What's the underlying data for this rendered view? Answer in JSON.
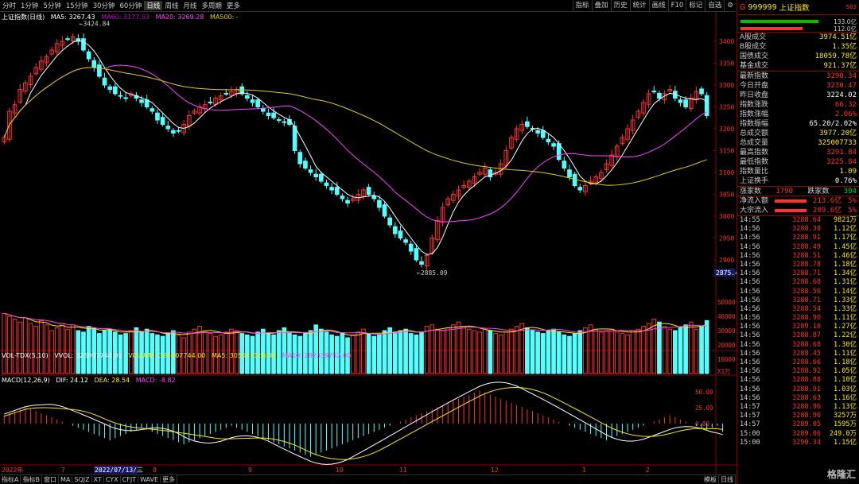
{
  "colors": {
    "up": "#ff3030",
    "down": "#54ffff",
    "ma5": "#ffffff",
    "ma60": "#c000c0",
    "ma20": "#ff40ff",
    "ma500": "#e0d000",
    "macd_dif": "#ffffff",
    "macd_dea": "#ffea00"
  },
  "periods": [
    "分时",
    "1分钟",
    "5分钟",
    "15分钟",
    "30分钟",
    "60分钟",
    "日线",
    "周线",
    "月线",
    "多周期",
    "更多"
  ],
  "active_period": "日线",
  "tools": [
    "指标",
    "叠加",
    "历史",
    "统计",
    "画线",
    "F10",
    "标记",
    "自选",
    "⚙"
  ],
  "price_legend": {
    "name": "上证指数(日线)",
    "ma5": "MA5: 3267.43",
    "ma60": "MA60: 3177.53",
    "ma20": "MA20: 3269.28",
    "ma500": "MA500: -"
  },
  "vol_legend": {
    "name": "VOL-TDX(5,10)",
    "vvol": "VVOL: 325007744.00",
    "volume": "VOLUME: 325007744.00",
    "ma5": "MA5: 305047168.00",
    "ma10": "MA10: 282339752.00"
  },
  "macd_legend": {
    "name": "MACD(12,26,9)",
    "dif": "DIF: 24.12",
    "dea": "DEA: 28.54",
    "macd": "MACD: -8.82"
  },
  "price_axis": [
    "3400",
    "3350",
    "3300",
    "3250",
    "3200",
    "3150",
    "3100",
    "3050",
    "3000",
    "2950",
    "2900"
  ],
  "vol_axis": [
    "50000",
    "40000",
    "30000",
    "20000",
    "10000"
  ],
  "vol_unit": "X1万",
  "macd_axis": [
    "50.00",
    "25.00",
    "0.00"
  ],
  "high_label": "3424.84",
  "low_label": "2885.09",
  "cursor_price": "2875.4",
  "date_axis": [
    "2022年",
    "7",
    "2022/07/13/三",
    "8",
    "9",
    "10",
    "11",
    "12",
    "1",
    "2"
  ],
  "chart_data": {
    "type": "candlestick",
    "ylim": [
      2880,
      3440
    ],
    "close": [
      3180,
      3240,
      3255,
      3290,
      3305,
      3320,
      3340,
      3355,
      3365,
      3380,
      3395,
      3400,
      3405,
      3410,
      3400,
      3380,
      3360,
      3340,
      3320,
      3300,
      3290,
      3280,
      3275,
      3270,
      3280,
      3270,
      3260,
      3250,
      3240,
      3220,
      3210,
      3200,
      3190,
      3195,
      3210,
      3230,
      3240,
      3250,
      3255,
      3260,
      3270,
      3275,
      3280,
      3285,
      3290,
      3280,
      3270,
      3260,
      3250,
      3240,
      3230,
      3225,
      3220,
      3215,
      3210,
      3150,
      3120,
      3110,
      3100,
      3090,
      3080,
      3070,
      3060,
      3050,
      3040,
      3030,
      3040,
      3050,
      3060,
      3050,
      3040,
      3020,
      3000,
      2980,
      2960,
      2950,
      2940,
      2920,
      2900,
      2890,
      2910,
      2950,
      2990,
      3020,
      3040,
      3050,
      3060,
      3070,
      3080,
      3090,
      3100,
      3110,
      3090,
      3100,
      3120,
      3150,
      3180,
      3200,
      3210,
      3205,
      3200,
      3190,
      3180,
      3170,
      3160,
      3130,
      3110,
      3090,
      3070,
      3060,
      3070,
      3080,
      3090,
      3100,
      3120,
      3140,
      3160,
      3180,
      3200,
      3220,
      3240,
      3260,
      3280,
      3285,
      3270,
      3280,
      3290,
      3270,
      3260,
      3250,
      3270,
      3285,
      3280,
      3230
    ]
  },
  "vol_data": [
    42,
    40,
    38,
    36,
    39,
    35,
    33,
    37,
    34,
    30,
    32,
    35,
    31,
    34,
    30,
    29,
    33,
    32,
    28,
    30,
    31,
    29,
    27,
    28,
    30,
    32,
    29,
    31,
    28,
    27,
    26,
    28,
    30,
    27,
    25,
    29,
    31,
    33,
    30,
    28,
    26,
    27,
    29,
    31,
    30,
    28,
    27,
    26,
    29,
    31,
    28,
    27,
    30,
    32,
    29,
    27,
    26,
    28,
    30,
    34,
    31,
    29,
    27,
    26,
    28,
    25,
    27,
    29,
    31,
    28,
    26,
    27,
    30,
    32,
    29,
    30,
    31,
    28,
    27,
    29,
    33,
    34,
    31,
    30,
    32,
    34,
    36,
    33,
    31,
    30,
    29,
    31,
    30,
    28,
    27,
    29,
    31,
    33,
    35,
    32,
    30,
    29,
    28,
    30,
    31,
    29,
    27,
    26,
    28,
    30,
    32,
    34,
    31,
    29,
    30,
    31,
    29,
    28,
    27,
    30,
    31,
    33,
    35,
    38,
    36,
    33,
    31,
    30,
    32,
    34,
    36,
    31,
    33,
    37
  ],
  "macd_data": [
    4,
    5,
    6,
    7,
    8,
    7,
    6,
    5,
    4,
    3,
    2,
    1,
    0,
    -1,
    -2,
    -3,
    -4,
    -5,
    -6,
    -7,
    -8,
    -7,
    -6,
    -5,
    -4,
    -3,
    -2,
    -3,
    -4,
    -5,
    -6,
    -7,
    -8,
    -9,
    -10,
    -9,
    -8,
    -7,
    -6,
    -5,
    -4,
    -3,
    -2,
    -1,
    -2,
    -3,
    -4,
    -5,
    -6,
    -7,
    -8,
    -9,
    -10,
    -11,
    -12,
    -13,
    -14,
    -15,
    -16,
    -15,
    -14,
    -13,
    -12,
    -11,
    -10,
    -9,
    -8,
    -7,
    -6,
    -5,
    -4,
    -3,
    -2,
    -1,
    0,
    1,
    2,
    3,
    4,
    5,
    6,
    7,
    8,
    9,
    10,
    11,
    12,
    13,
    14,
    15,
    16,
    15,
    14,
    13,
    12,
    11,
    10,
    9,
    8,
    7,
    6,
    5,
    4,
    3,
    2,
    1,
    0,
    -1,
    -2,
    -3,
    -4,
    -5,
    -6,
    -7,
    -8,
    -7,
    -6,
    -5,
    -4,
    -3,
    -2,
    -1,
    0,
    1,
    2,
    3,
    4,
    3,
    2,
    1,
    0,
    -1,
    -2,
    -3,
    -2,
    -1,
    -4
  ],
  "right": {
    "code_prefix": "G",
    "code": "999999",
    "name": "上证指数",
    "num": "563",
    "ratio1": "133.0亿",
    "ratio2": "112.0亿",
    "stats1": [
      {
        "l": "A股成交",
        "v": "3974.51亿",
        "c": "yellow"
      },
      {
        "l": "B股成交",
        "v": "1.35亿",
        "c": "yellow"
      },
      {
        "l": "国债成交",
        "v": "18059.78亿",
        "c": "yellow"
      },
      {
        "l": "基金成交",
        "v": "921.37亿",
        "c": "yellow"
      }
    ],
    "stats2": [
      {
        "l": "最新指数",
        "v": "3290.34",
        "c": "red"
      },
      {
        "l": "今日开盘",
        "v": "3230.47",
        "c": "red"
      },
      {
        "l": "昨日收盘",
        "v": "3224.02",
        "c": "white"
      },
      {
        "l": "指数涨跌",
        "v": "66.32",
        "c": "red"
      },
      {
        "l": "指数涨幅",
        "v": "2.06%",
        "c": "red"
      },
      {
        "l": "指数振幅",
        "v": "65.20/2.02%",
        "c": "white"
      },
      {
        "l": "总成交额",
        "v": "3977.20亿",
        "c": "yellow"
      },
      {
        "l": "总成交量",
        "v": "325007733",
        "c": "yellow"
      },
      {
        "l": "最高指数",
        "v": "3291.84",
        "c": "red"
      },
      {
        "l": "最低指数",
        "v": "3225.84",
        "c": "red"
      },
      {
        "l": "指数量比",
        "v": "1.09",
        "c": "yellow"
      },
      {
        "l": "上证换手",
        "v": "0.76%",
        "c": "white"
      }
    ],
    "updown": {
      "up_l": "涨家数",
      "up_v": "1790",
      "down_l": "跌家数",
      "down_v": "394"
    },
    "flows": [
      {
        "l": "净流入额",
        "v": "213.6亿",
        "p": "5%"
      },
      {
        "l": "大宗流入",
        "v": "209.6亿",
        "p": "5%"
      }
    ],
    "ticks": [
      [
        "14:55",
        "3288.64",
        "9821万"
      ],
      [
        "14:56",
        "3288.38",
        "1.12亿"
      ],
      [
        "14:56",
        "3288.91",
        "1.17亿"
      ],
      [
        "14:56",
        "3288.49",
        "1.45亿"
      ],
      [
        "14:56",
        "3288.51",
        "1.46亿"
      ],
      [
        "14:56",
        "3288.78",
        "1.18亿"
      ],
      [
        "14:56",
        "3288.71",
        "1.34亿"
      ],
      [
        "14:56",
        "3288.68",
        "1.31亿"
      ],
      [
        "14:56",
        "3288.56",
        "1.14亿"
      ],
      [
        "14:56",
        "3288.71",
        "1.33亿"
      ],
      [
        "14:56",
        "3288.54",
        "1.33亿"
      ],
      [
        "14:56",
        "3288.90",
        "1.11亿"
      ],
      [
        "14:56",
        "3289.10",
        "1.27亿"
      ],
      [
        "14:56",
        "3288.87",
        "1.22亿"
      ],
      [
        "14:56",
        "3288.68",
        "1.30亿"
      ],
      [
        "14:56",
        "3288.45",
        "1.11亿"
      ],
      [
        "14:56",
        "3288.66",
        "1.18亿"
      ],
      [
        "14:56",
        "3288.92",
        "1.05亿"
      ],
      [
        "14:56",
        "3288.88",
        "1.10亿"
      ],
      [
        "14:56",
        "3288.91",
        "1.03亿"
      ],
      [
        "14:56",
        "3288.63",
        "1.16亿"
      ],
      [
        "14:57",
        "3288.96",
        "1.13亿"
      ],
      [
        "14:57",
        "3288.96",
        "3257万"
      ],
      [
        "14:57",
        "3289.05",
        "1595万"
      ],
      [
        "15:00",
        "3289.06",
        "249.0万"
      ],
      [
        "15:00",
        "3290.34",
        "1.15亿"
      ]
    ]
  },
  "bottom_tabs": [
    "指标A",
    "指标B",
    "窗口",
    "MA",
    "SQJZ",
    "XT",
    "CYX",
    "CFJT",
    "WAVE",
    "更多"
  ],
  "bottom_right": [
    "模板",
    "日线"
  ],
  "watermark": "格隆汇"
}
